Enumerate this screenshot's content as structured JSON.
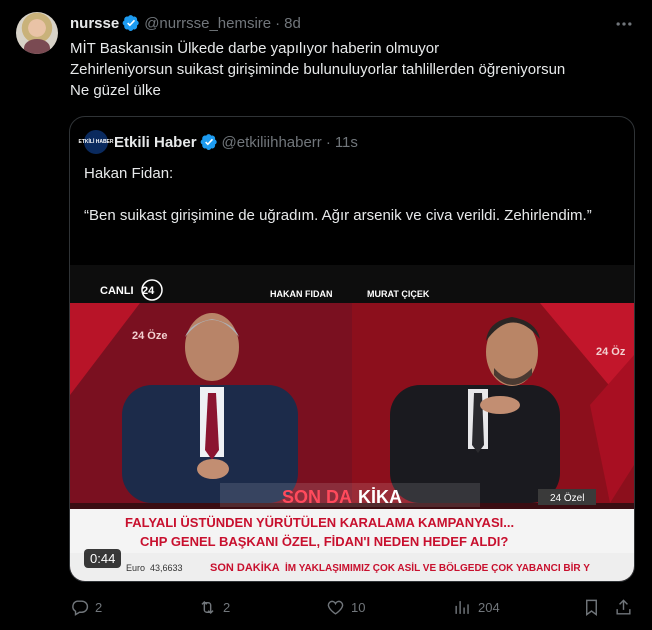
{
  "tweet": {
    "author_name": "nursse",
    "handle": "@nurrsse_hemsire",
    "time": "8d",
    "lines": [
      "MİT Baskanısin Ülkede darbe yapılıyor haberin olmuyor",
      "Zehirleniyorsun suikast girişiminde bulunuluyorlar tahlillerden öğreniyorsun",
      "Ne güzel ülke"
    ]
  },
  "quote": {
    "avatar_text": "ETKİLİ HABER",
    "author_name": "Etkili Haber",
    "handle": "@etkiliihhaberr",
    "time": "11s",
    "paragraph1": "Hakan Fidan:",
    "paragraph2": "“Ben suikast girişimine de uğradım. Ağır arsenik ve civa verildi. Zehirlendim.”"
  },
  "video": {
    "duration": "0:44",
    "live_label": "CANLI",
    "channel_number": "24",
    "guest_name": "HAKAN FIDAN",
    "host_name": "MURAT ÇIÇEK",
    "watermark_left": "24 Öze",
    "watermark_right": "24 Öz",
    "breaking_part1": "SON DA",
    "breaking_part2": "KİKA",
    "program_tag": "24 Özel",
    "headline1": "FALYALI ÜSTÜNDEN YÜRÜTÜLEN KARALAMA KAMPANYASI...",
    "headline2": "CHP GENEL BAŞKANI ÖZEL, FİDAN'I NEDEN HEDEF ALDI?",
    "ticker_currency": "Euro",
    "ticker_value": "43,6633",
    "ticker_label": "SON DAKİKA",
    "ticker_text": "İM YAKLAŞIMIMIZ ÇOK ASİL VE BÖLGEDE ÇOK YABANCI BİR Y"
  },
  "actions": {
    "replies": "2",
    "reposts": "2",
    "likes": "10",
    "views": "204"
  },
  "colors": {
    "background": "#000000",
    "text": "#e7e9ea",
    "muted": "#71767b",
    "verified": "#1d9bf0",
    "border": "#2f3336",
    "tv_red": "#c8102e"
  }
}
